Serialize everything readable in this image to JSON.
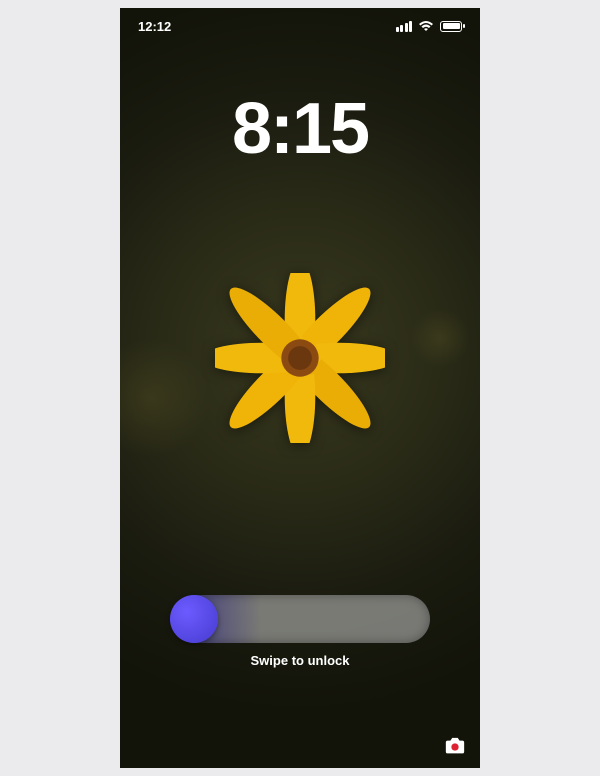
{
  "status_bar": {
    "time": "12:12"
  },
  "lock_screen": {
    "clock": "8:15",
    "slider_label": "Swipe to unlock"
  },
  "colors": {
    "slider_accent": "#463bcf",
    "flower_petal": "#f2b90d",
    "flower_center": "#8a4a12"
  }
}
